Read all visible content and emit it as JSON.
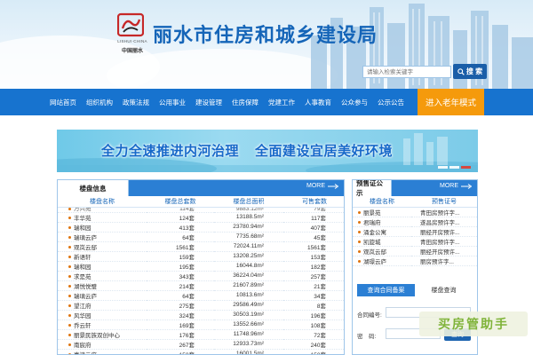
{
  "header": {
    "logo_en": "LISHUI·CHINA",
    "logo_cn": "中国丽水",
    "title": "丽水市住房和城乡建设局",
    "search_placeholder": "请输入检索关键字",
    "search_button": "搜 索",
    "search_icon": "magnifier-icon"
  },
  "nav": {
    "items": [
      "网站首页",
      "组织机构",
      "政策法规",
      "公用事业",
      "建设管理",
      "住房保障",
      "党建工作",
      "人事教育",
      "公众参与",
      "公示公告"
    ],
    "elder_mode": "进入老年模式"
  },
  "banner": {
    "text_left": "全力全速推进内河治理",
    "text_right": "全面建设宜居美好环境"
  },
  "property_panel": {
    "tab": "楼盘信息",
    "more": "MORE",
    "columns": [
      "楼盘名称",
      "楼盘总套数",
      "楼盘总面积",
      "可售套数"
    ],
    "clipped_row": [
      "万兴苑",
      "114套",
      "9883.12m²",
      "79套"
    ],
    "rows": [
      [
        "丰华苑",
        "124套",
        "13188.5m²",
        "117套"
      ],
      [
        "瑞和园",
        "413套",
        "23780.94m²",
        "407套"
      ],
      [
        "瑞璃云庐",
        "64套",
        "7735.68m²",
        "45套"
      ],
      [
        "观岚云邸",
        "1561套",
        "72024.11m²",
        "1561套"
      ],
      [
        "新语轩",
        "159套",
        "13208.25m²",
        "153套"
      ],
      [
        "瑞和园",
        "195套",
        "16044.8m²",
        "182套"
      ],
      [
        "求是苑",
        "343套",
        "36224.04m²",
        "257套"
      ],
      [
        "湖悦悦璧",
        "214套",
        "21607.89m²",
        "21套"
      ],
      [
        "瑞璃云庐",
        "64套",
        "10813.6m²",
        "34套"
      ],
      [
        "望江府",
        "275套",
        "29586.49m²",
        "8套"
      ],
      [
        "风华园",
        "324套",
        "30503.19m²",
        "196套"
      ],
      [
        "乔云轩",
        "169套",
        "13552.66m²",
        "108套"
      ],
      [
        "丽景民族双创中心",
        "176套",
        "11748.96m²",
        "72套"
      ],
      [
        "南宸府",
        "267套",
        "12933.73m²",
        "240套"
      ]
    ],
    "bottom_clipped_row": [
      "嘉鸿云府",
      "150套",
      "16001.5m²",
      "150套"
    ]
  },
  "presale_panel": {
    "tab": "预售证公示",
    "more": "MORE",
    "columns": [
      "楼盘名称",
      "预售证号"
    ],
    "rows": [
      [
        "丽景苑",
        "青田房预许字..."
      ],
      [
        "君瑞府",
        "遂昌房预许字..."
      ],
      [
        "涌金公寓",
        "丽经开房预许..."
      ],
      [
        "凯旋城",
        "青田房预许字..."
      ],
      [
        "观岚云邸",
        "丽经开房预许..."
      ],
      [
        "湖璟云庐",
        "丽房预许字..."
      ]
    ],
    "query_tabs": [
      "查询合同备案",
      "楼盘查询"
    ],
    "contract_label": "合同编号:",
    "password_label": "密　码:",
    "query_button": "查询"
  },
  "watermark": "买房管助手",
  "colors": {
    "nav_blue": "#1773cf",
    "title_blue": "#1565b8",
    "elder_orange": "#f59a0c",
    "banner_dot_active": "#e23b2f"
  }
}
